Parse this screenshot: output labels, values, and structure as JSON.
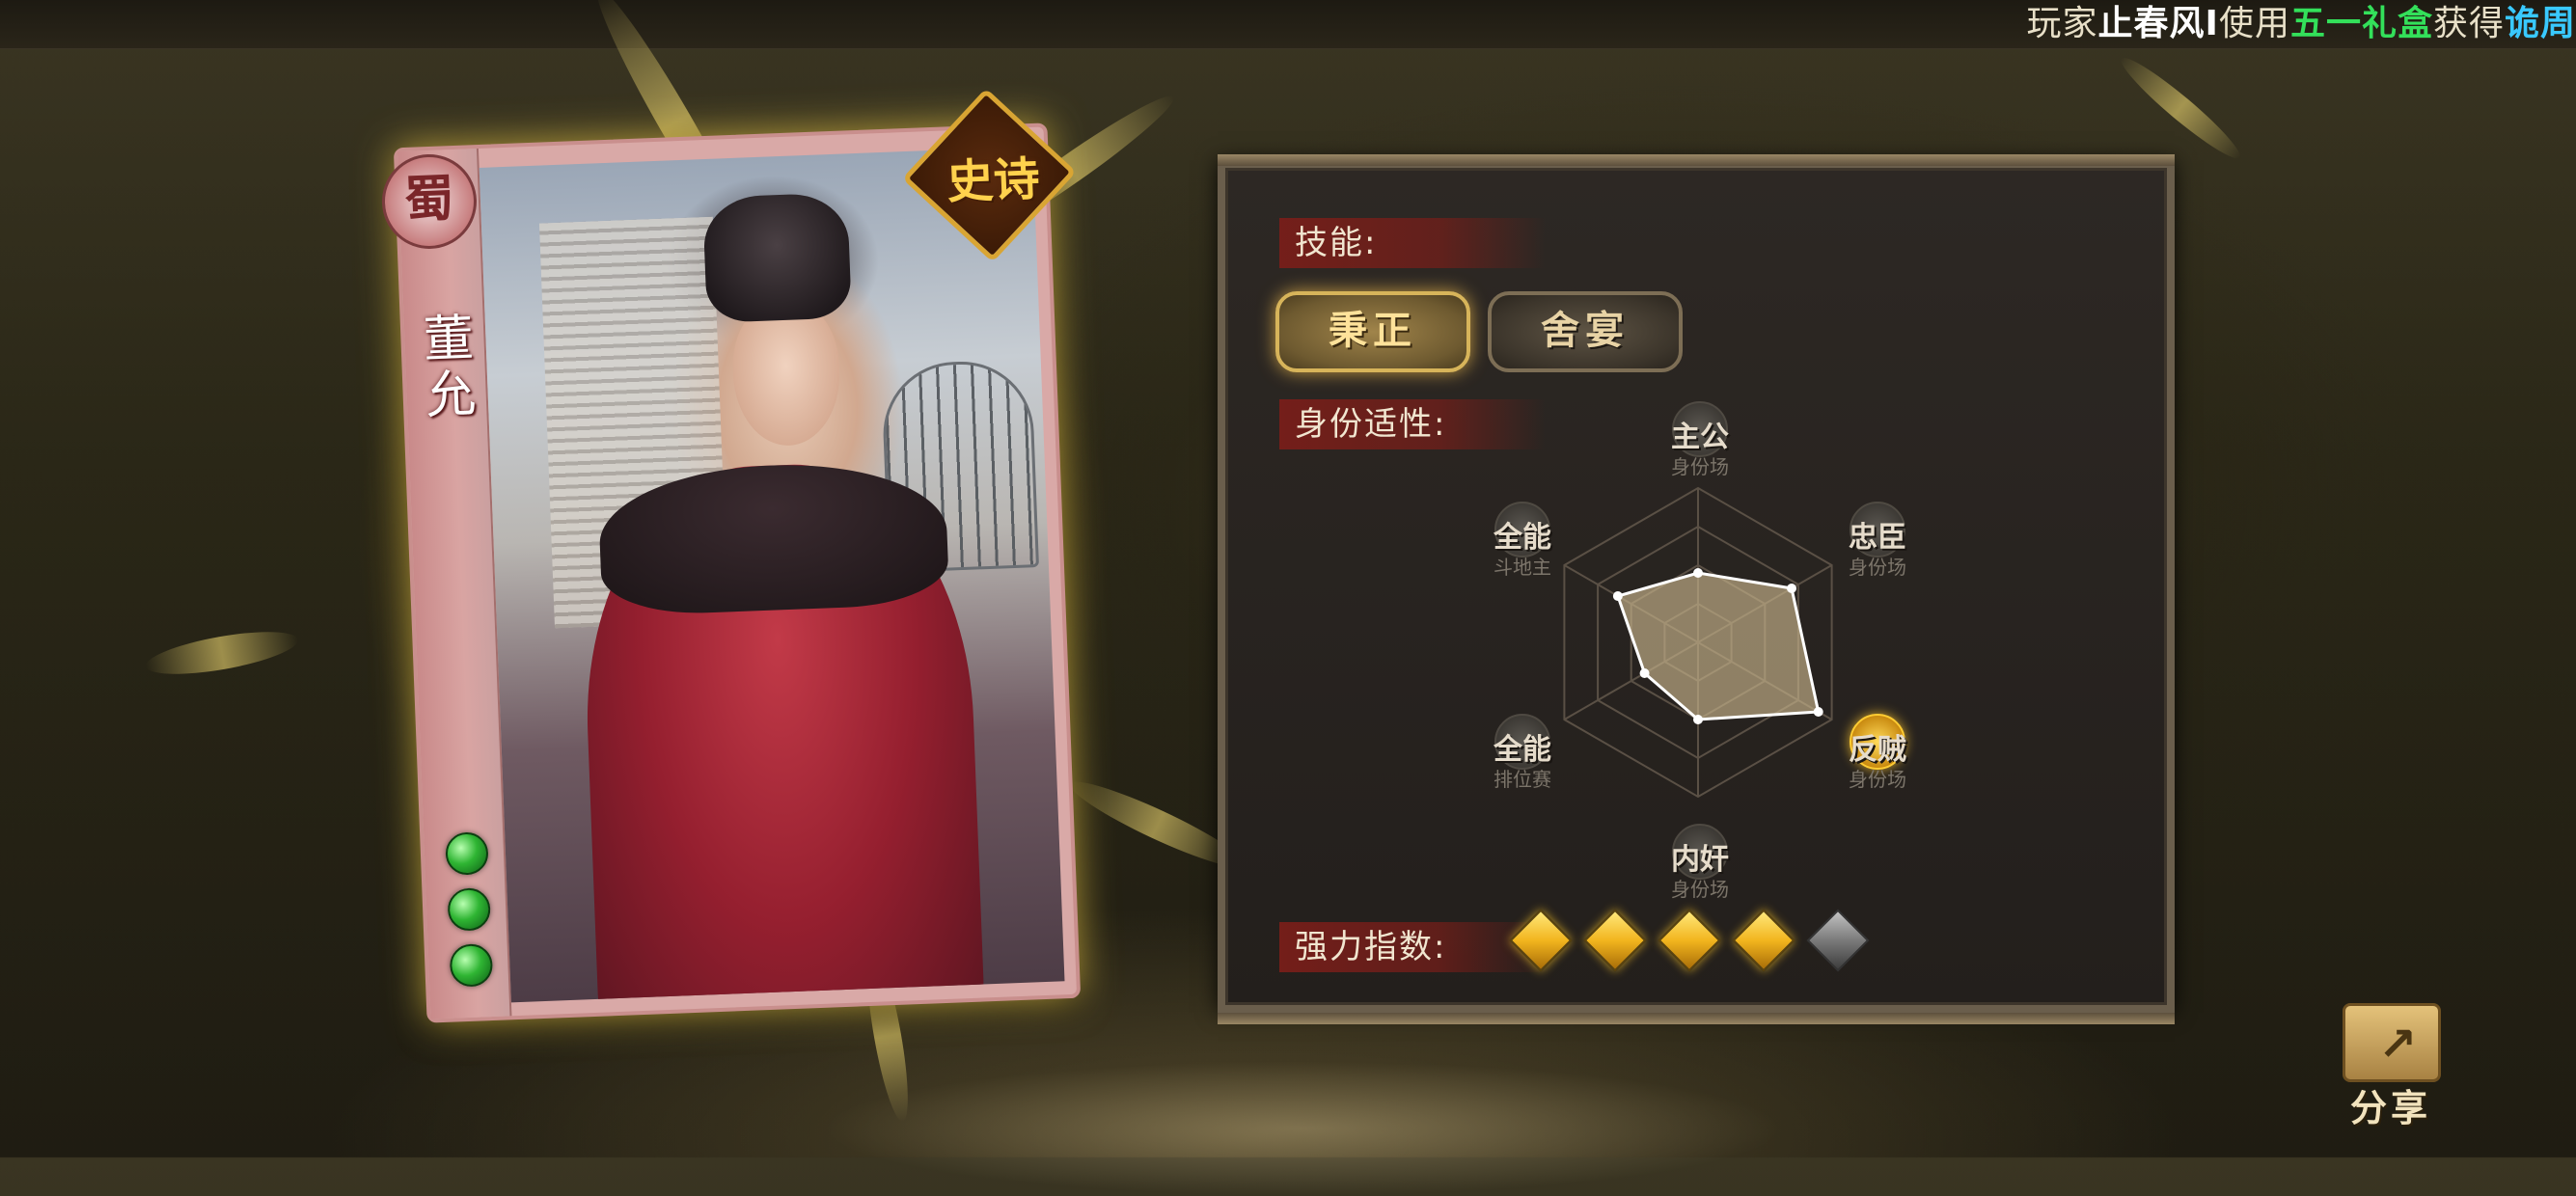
{
  "banner": {
    "prefix": "玩家",
    "player": "止春风I",
    "verb": "使用",
    "item": "五一礼盒",
    "result": "获得",
    "card": "诡周"
  },
  "hero": {
    "faction": "蜀",
    "name": "董允",
    "rarity": "史诗",
    "hp": 3
  },
  "panel": {
    "skills_label": "技能:",
    "skills": [
      {
        "name": "秉正",
        "selected": true
      },
      {
        "name": "舍宴",
        "selected": false
      }
    ],
    "identity_label": "身份适性:",
    "roles": [
      {
        "name": "主公",
        "sub": "身份场",
        "score": 0.45,
        "hot": false
      },
      {
        "name": "忠臣",
        "sub": "身份场",
        "score": 0.7,
        "hot": false
      },
      {
        "name": "反贼",
        "sub": "身份场",
        "score": 0.9,
        "hot": true
      },
      {
        "name": "内奸",
        "sub": "身份场",
        "score": 0.5,
        "hot": false
      },
      {
        "name": "全能",
        "sub": "排位赛",
        "score": 0.4,
        "hot": false
      },
      {
        "name": "全能",
        "sub": "斗地主",
        "score": 0.6,
        "hot": false
      }
    ],
    "power_label": "强力指数:",
    "power": 4,
    "power_max": 5
  },
  "share": {
    "label": "分享"
  },
  "colors": {
    "player": "#ffffff",
    "item": "#33e05a",
    "card": "#39c9ff",
    "gold": "#f2b51e"
  }
}
